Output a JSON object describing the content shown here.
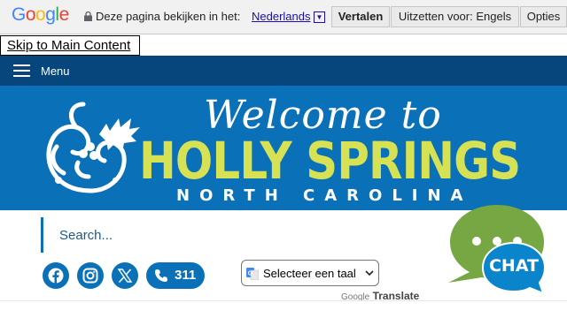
{
  "translate_bar": {
    "logo": [
      "G",
      "o",
      "o",
      "g",
      "l",
      "e"
    ],
    "logo_colors": [
      "#4285f4",
      "#ea4335",
      "#fbbc05",
      "#4285f4",
      "#34a853",
      "#ea4335"
    ],
    "prompt": "Deze pagina bekijken in het:",
    "language": "Nederlands",
    "translate_button": "Vertalen",
    "disable_button": "Uitzetten voor: Engels",
    "options_button": "Opties"
  },
  "skip_link": "Skip to Main Content",
  "menu": {
    "label": "Menu"
  },
  "banner": {
    "welcome": "Welcome to",
    "city": "HOLLY SPRINGS",
    "state": "NORTH CAROLINA"
  },
  "search": {
    "placeholder": "Search..."
  },
  "social": {
    "icons": [
      "facebook-icon",
      "instagram-icon",
      "x-icon"
    ],
    "phone": "311"
  },
  "language_select": {
    "selected": "Selecteer een taal",
    "powered_google": "Google",
    "powered_translate": "Translate"
  },
  "chat": {
    "label": "CHAT"
  },
  "colors": {
    "navy": "#06467c",
    "brand_blue": "#0a70b8",
    "lime": "#d6e154",
    "chat_green": "#76a743"
  }
}
